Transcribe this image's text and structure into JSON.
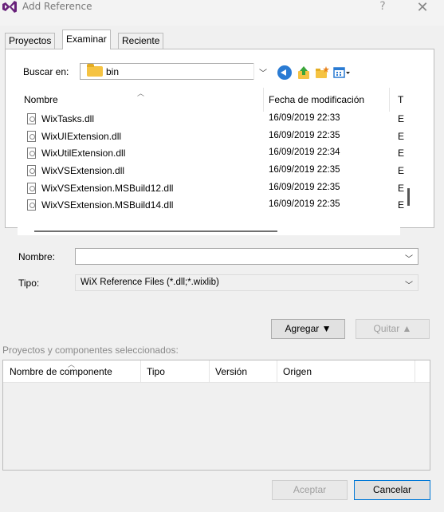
{
  "window": {
    "title": "Add Reference",
    "help": "?",
    "close": "✕"
  },
  "tabs": [
    "Proyectos",
    "Examinar",
    "Reciente"
  ],
  "lookin": {
    "label": "Buscar en:",
    "value": "bin"
  },
  "filelist": {
    "columns": [
      "Nombre",
      "Fecha de modificación",
      "T"
    ],
    "rows": [
      {
        "name": "WixTasks.dll",
        "date": "16/09/2019 22:33",
        "type": "E"
      },
      {
        "name": "WixUIExtension.dll",
        "date": "16/09/2019 22:35",
        "type": "E"
      },
      {
        "name": "WixUtilExtension.dll",
        "date": "16/09/2019 22:34",
        "type": "E"
      },
      {
        "name": "WixVSExtension.dll",
        "date": "16/09/2019 22:35",
        "type": "E"
      },
      {
        "name": "WixVSExtension.MSBuild12.dll",
        "date": "16/09/2019 22:35",
        "type": "E"
      },
      {
        "name": "WixVSExtension.MSBuild14.dll",
        "date": "16/09/2019 22:35",
        "type": "E"
      }
    ]
  },
  "filename": {
    "label": "Nombre:",
    "value": ""
  },
  "filetype": {
    "label": "Tipo:",
    "value": "WiX Reference Files (*.dll;*.wixlib)"
  },
  "actions": {
    "add": "Agregar ▼",
    "remove": "Quitar ▲"
  },
  "selected": {
    "label": "Proyectos y componentes seleccionados:",
    "columns": [
      "Nombre de componente",
      "Tipo",
      "Versión",
      "Origen"
    ]
  },
  "footer": {
    "ok": "Aceptar",
    "cancel": "Cancelar"
  },
  "colors": {
    "vs_purple": "#68217a",
    "accent_blue": "#0078d7",
    "folder_yellow": "#f5c342"
  },
  "icons": [
    "visual-studio-logo-icon",
    "folder-icon",
    "back-icon",
    "up-folder-icon",
    "new-folder-icon",
    "views-icon",
    "dll-file-icon"
  ]
}
